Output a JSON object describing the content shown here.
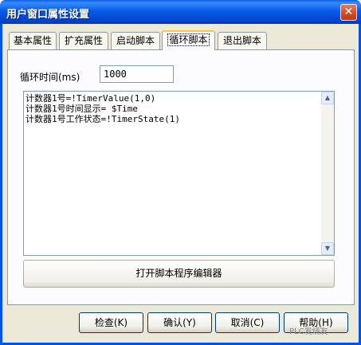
{
  "window": {
    "title": "用户窗口属性设置",
    "close_glyph": "✕"
  },
  "tabs": [
    {
      "label": "基本属性",
      "active": false
    },
    {
      "label": "扩充属性",
      "active": false
    },
    {
      "label": "启动脚本",
      "active": false
    },
    {
      "label": "循环脚本",
      "active": true
    },
    {
      "label": "退出脚本",
      "active": false
    }
  ],
  "cycle": {
    "label": "循环时间(ms)",
    "value": "1000"
  },
  "script": {
    "lines": [
      "计数器1号=!TimerValue(1,0)",
      "计数器1号时间显示= $Time",
      "计数器1号工作状态=!TimerState(1)"
    ]
  },
  "open_editor_label": "打开脚本程序编辑器",
  "buttons": {
    "check": "检查(K)",
    "ok": "确认(Y)",
    "cancel": "取消(C)",
    "help": "帮助(H)"
  },
  "watermark": "PLC发烧友",
  "icons": {
    "scroll_up": "scroll-up-arrow-icon",
    "scroll_down": "scroll-down-arrow-icon"
  },
  "colors": {
    "titlebar": "#0054e3",
    "dialog_bg": "#ece9d8",
    "active_tab_accent": "#ffc83c"
  }
}
